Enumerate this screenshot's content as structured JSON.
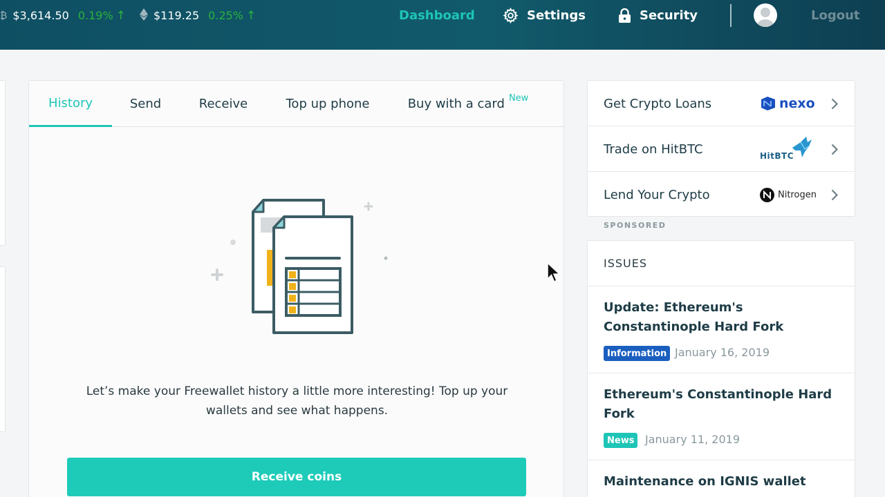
{
  "ticker": [
    {
      "icon": "bitcoin-icon",
      "price": "$3,614.50",
      "change": "0.19%"
    },
    {
      "icon": "ethereum-icon",
      "price": "$119.25",
      "change": "0.25%"
    }
  ],
  "nav": {
    "dashboard": "Dashboard",
    "settings": "Settings",
    "security": "Security",
    "logout": "Logout"
  },
  "tabs": [
    {
      "label": "History",
      "active": true
    },
    {
      "label": "Send"
    },
    {
      "label": "Receive"
    },
    {
      "label": "Top up phone"
    },
    {
      "label": "Buy with a card",
      "badge": "New"
    }
  ],
  "history": {
    "empty_text": "Let’s make your Freewallet history a little more interesting! Top up your wallets and see what happens.",
    "receive_button": "Receive coins"
  },
  "partners": [
    {
      "label": "Get Crypto Loans",
      "logo_text": "nexo"
    },
    {
      "label": "Trade on HitBTC",
      "logo_text": "HitBTC"
    },
    {
      "label": "Lend Your Crypto",
      "logo_text": "Nitrogen"
    }
  ],
  "sponsored_label": "SPONSORED",
  "issues": {
    "heading": "ISSUES",
    "items": [
      {
        "title": "Update: Ethereum's Constantinople Hard Fork",
        "badge": "Information",
        "badge_color": "#1a5fc0",
        "date": "January 16, 2019"
      },
      {
        "title": "Ethereum's Constantinople Hard Fork",
        "badge": "News",
        "badge_color": "#1ec5b7",
        "date": "January 11, 2019"
      },
      {
        "title": "Maintenance on IGNIS wallet"
      }
    ]
  },
  "colors": {
    "accent": "#1ec5b7",
    "header_bg": "#115a6b",
    "positive": "#28b33d"
  }
}
